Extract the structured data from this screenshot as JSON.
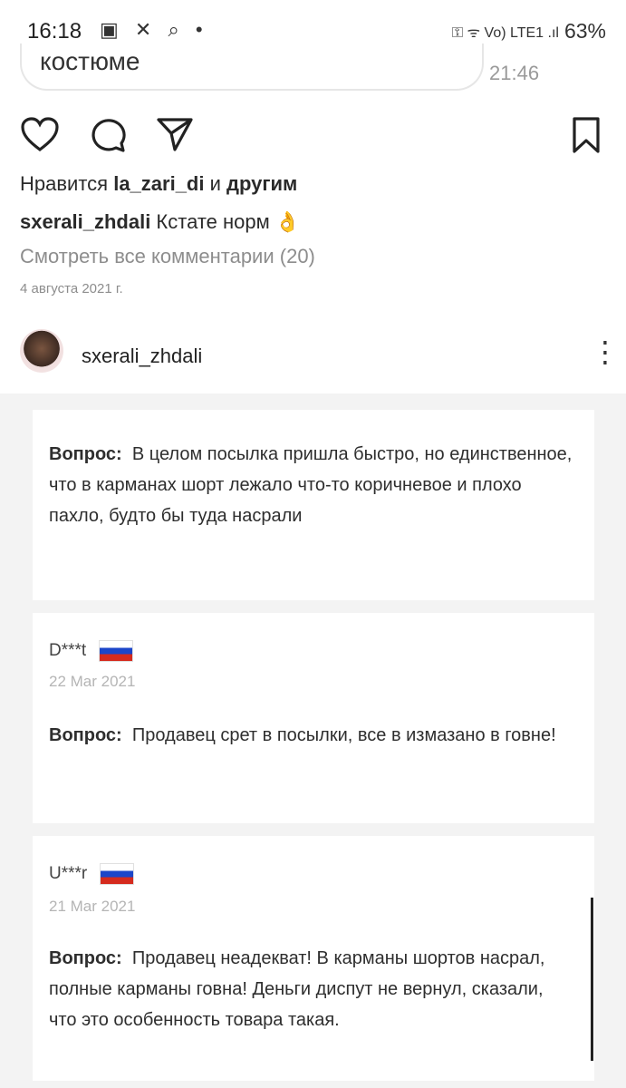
{
  "status_bar": {
    "time": "16:18",
    "left_icons": "▣ ✕ ⌕ •",
    "right_icons": "⚿ ᯤ Vo) LTE1 .ıl",
    "battery": "63%"
  },
  "chat_bubble": {
    "text": "костюме",
    "time": "21:46"
  },
  "post": {
    "likes_prefix": "Нравится ",
    "likes_user": "la_zari_di",
    "likes_mid": " и ",
    "likes_suffix": "другим",
    "caption_user": "sxerali_zhdali",
    "caption_text": " Кстате норм 👌",
    "view_comments": "Смотреть все комментарии (20)",
    "date": "4 августа 2021 г."
  },
  "next_post": {
    "username": "sxerali_zhdali",
    "more": "⋮"
  },
  "reviews": [
    {
      "user": "",
      "date": "",
      "label": "Вопрос",
      "text": "В целом посылка пришла быстро, но единственное, что в карманах шорт лежало что-то коричневое и плохо пахло, будто бы туда насрали"
    },
    {
      "user": "D***t",
      "date": "22 Mar 2021",
      "label": "Вопрос",
      "text": "Продавец срет в посылки, все в измазано в говне!"
    },
    {
      "user": "U***r",
      "date": "21 Mar 2021",
      "label": "Вопрос",
      "text": "Продавец неадекват! В карманы шортов насрал, полные карманы говна! Деньги диспут не вернул, сказали, что это особенность товара такая."
    }
  ],
  "icons": [
    "heart-icon",
    "comment-icon",
    "share-icon",
    "bookmark-icon",
    "more-icon"
  ]
}
